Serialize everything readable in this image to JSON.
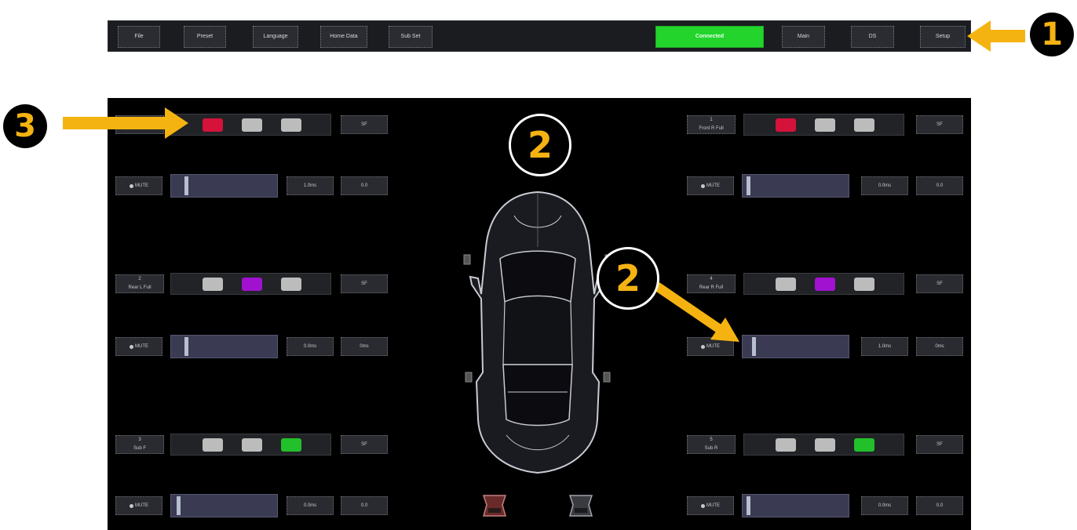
{
  "toolbar": {
    "buttons": [
      {
        "label": "File"
      },
      {
        "label": "Preset"
      },
      {
        "label": "Language"
      },
      {
        "label": "Home Data"
      },
      {
        "label": "Sub Set"
      }
    ],
    "status": "Connected",
    "right_buttons": [
      {
        "label": "Main"
      },
      {
        "label": "DS"
      },
      {
        "label": "Setup"
      }
    ]
  },
  "channels": {
    "left": [
      {
        "name_line1": "",
        "name_line2": "",
        "swatches": [
          "#d4123a",
          "#bcbcbc",
          "#bcbcbc"
        ],
        "btn": "SF",
        "mute": "MUTE",
        "ms": "1.0ms",
        "ms_btn": "0.0",
        "level": 0.12
      },
      {
        "name_line1": "2",
        "name_line2": "Rear L Full",
        "swatches": [
          "#bcbcbc",
          "#a012d0",
          "#bcbcbc"
        ],
        "btn": "SF",
        "mute": "MUTE",
        "ms": "0.0ms",
        "ms_btn": "0ms",
        "level": 0.12
      },
      {
        "name_line1": "3",
        "name_line2": "Sub F",
        "swatches": [
          "#bcbcbc",
          "#bcbcbc",
          "#22c02a"
        ],
        "btn": "SF",
        "mute": "MUTE",
        "ms": "0.0ms",
        "ms_btn": "0.0",
        "level": 0.04
      }
    ],
    "right": [
      {
        "name_line1": "1",
        "name_line2": "Front R Full",
        "swatches": [
          "#d4123a",
          "#bcbcbc",
          "#bcbcbc"
        ],
        "btn": "SF",
        "mute": "MUTE",
        "ms": "0.0ms",
        "ms_btn": "0.0",
        "level": 0.02
      },
      {
        "name_line1": "4",
        "name_line2": "Rear R Full",
        "swatches": [
          "#bcbcbc",
          "#a012d0",
          "#bcbcbc"
        ],
        "btn": "SF",
        "mute": "MUTE",
        "ms": "1.0ms",
        "ms_btn": "0ms",
        "level": 0.08
      },
      {
        "name_line1": "5",
        "name_line2": "Sub R",
        "swatches": [
          "#bcbcbc",
          "#bcbcbc",
          "#22c02a"
        ],
        "btn": "SF",
        "mute": "MUTE",
        "ms": "0.0ms",
        "ms_btn": "0.0",
        "level": 0.02
      }
    ]
  },
  "annotations": {
    "one": "1",
    "two": "2",
    "three": "3"
  },
  "colors": {
    "accent_arrow": "#f5b312",
    "connected": "#22d42c"
  }
}
